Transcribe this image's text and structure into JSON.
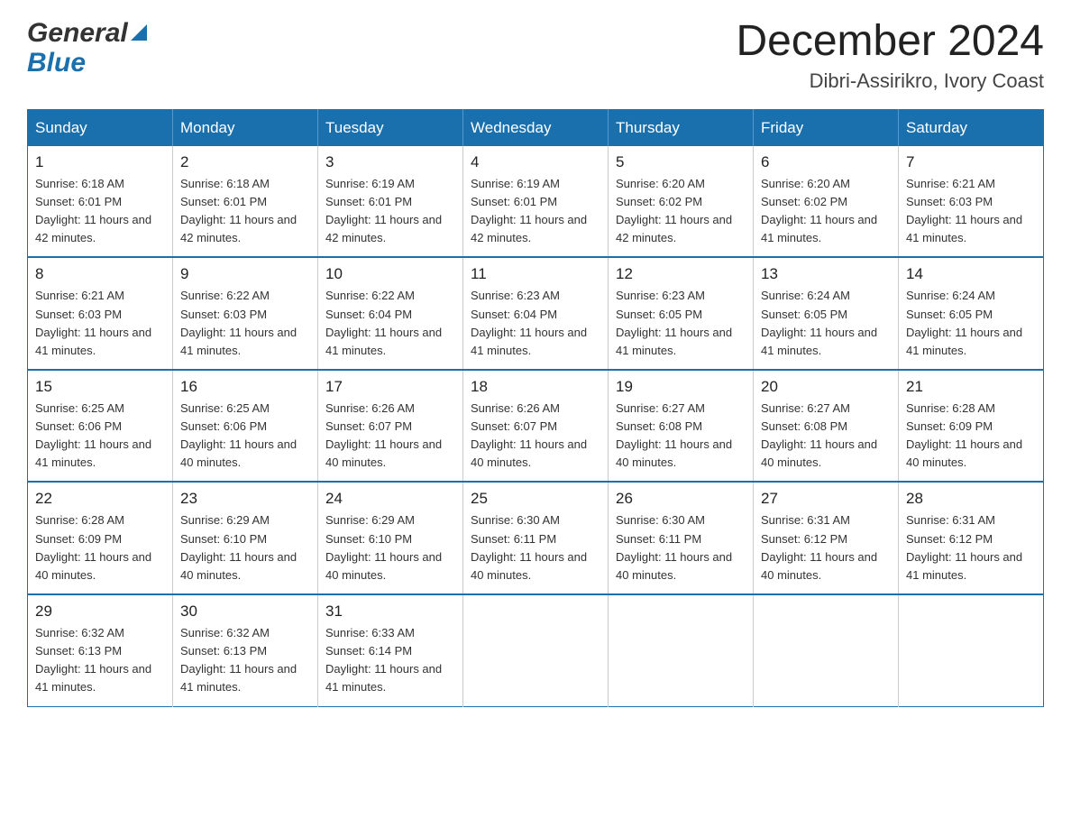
{
  "header": {
    "logo_general": "General",
    "logo_blue": "Blue",
    "main_title": "December 2024",
    "subtitle": "Dibri-Assirikro, Ivory Coast"
  },
  "calendar": {
    "days_of_week": [
      "Sunday",
      "Monday",
      "Tuesday",
      "Wednesday",
      "Thursday",
      "Friday",
      "Saturday"
    ],
    "weeks": [
      [
        {
          "day": "1",
          "sunrise": "6:18 AM",
          "sunset": "6:01 PM",
          "daylight": "11 hours and 42 minutes."
        },
        {
          "day": "2",
          "sunrise": "6:18 AM",
          "sunset": "6:01 PM",
          "daylight": "11 hours and 42 minutes."
        },
        {
          "day": "3",
          "sunrise": "6:19 AM",
          "sunset": "6:01 PM",
          "daylight": "11 hours and 42 minutes."
        },
        {
          "day": "4",
          "sunrise": "6:19 AM",
          "sunset": "6:01 PM",
          "daylight": "11 hours and 42 minutes."
        },
        {
          "day": "5",
          "sunrise": "6:20 AM",
          "sunset": "6:02 PM",
          "daylight": "11 hours and 42 minutes."
        },
        {
          "day": "6",
          "sunrise": "6:20 AM",
          "sunset": "6:02 PM",
          "daylight": "11 hours and 41 minutes."
        },
        {
          "day": "7",
          "sunrise": "6:21 AM",
          "sunset": "6:03 PM",
          "daylight": "11 hours and 41 minutes."
        }
      ],
      [
        {
          "day": "8",
          "sunrise": "6:21 AM",
          "sunset": "6:03 PM",
          "daylight": "11 hours and 41 minutes."
        },
        {
          "day": "9",
          "sunrise": "6:22 AM",
          "sunset": "6:03 PM",
          "daylight": "11 hours and 41 minutes."
        },
        {
          "day": "10",
          "sunrise": "6:22 AM",
          "sunset": "6:04 PM",
          "daylight": "11 hours and 41 minutes."
        },
        {
          "day": "11",
          "sunrise": "6:23 AM",
          "sunset": "6:04 PM",
          "daylight": "11 hours and 41 minutes."
        },
        {
          "day": "12",
          "sunrise": "6:23 AM",
          "sunset": "6:05 PM",
          "daylight": "11 hours and 41 minutes."
        },
        {
          "day": "13",
          "sunrise": "6:24 AM",
          "sunset": "6:05 PM",
          "daylight": "11 hours and 41 minutes."
        },
        {
          "day": "14",
          "sunrise": "6:24 AM",
          "sunset": "6:05 PM",
          "daylight": "11 hours and 41 minutes."
        }
      ],
      [
        {
          "day": "15",
          "sunrise": "6:25 AM",
          "sunset": "6:06 PM",
          "daylight": "11 hours and 41 minutes."
        },
        {
          "day": "16",
          "sunrise": "6:25 AM",
          "sunset": "6:06 PM",
          "daylight": "11 hours and 40 minutes."
        },
        {
          "day": "17",
          "sunrise": "6:26 AM",
          "sunset": "6:07 PM",
          "daylight": "11 hours and 40 minutes."
        },
        {
          "day": "18",
          "sunrise": "6:26 AM",
          "sunset": "6:07 PM",
          "daylight": "11 hours and 40 minutes."
        },
        {
          "day": "19",
          "sunrise": "6:27 AM",
          "sunset": "6:08 PM",
          "daylight": "11 hours and 40 minutes."
        },
        {
          "day": "20",
          "sunrise": "6:27 AM",
          "sunset": "6:08 PM",
          "daylight": "11 hours and 40 minutes."
        },
        {
          "day": "21",
          "sunrise": "6:28 AM",
          "sunset": "6:09 PM",
          "daylight": "11 hours and 40 minutes."
        }
      ],
      [
        {
          "day": "22",
          "sunrise": "6:28 AM",
          "sunset": "6:09 PM",
          "daylight": "11 hours and 40 minutes."
        },
        {
          "day": "23",
          "sunrise": "6:29 AM",
          "sunset": "6:10 PM",
          "daylight": "11 hours and 40 minutes."
        },
        {
          "day": "24",
          "sunrise": "6:29 AM",
          "sunset": "6:10 PM",
          "daylight": "11 hours and 40 minutes."
        },
        {
          "day": "25",
          "sunrise": "6:30 AM",
          "sunset": "6:11 PM",
          "daylight": "11 hours and 40 minutes."
        },
        {
          "day": "26",
          "sunrise": "6:30 AM",
          "sunset": "6:11 PM",
          "daylight": "11 hours and 40 minutes."
        },
        {
          "day": "27",
          "sunrise": "6:31 AM",
          "sunset": "6:12 PM",
          "daylight": "11 hours and 40 minutes."
        },
        {
          "day": "28",
          "sunrise": "6:31 AM",
          "sunset": "6:12 PM",
          "daylight": "11 hours and 41 minutes."
        }
      ],
      [
        {
          "day": "29",
          "sunrise": "6:32 AM",
          "sunset": "6:13 PM",
          "daylight": "11 hours and 41 minutes."
        },
        {
          "day": "30",
          "sunrise": "6:32 AM",
          "sunset": "6:13 PM",
          "daylight": "11 hours and 41 minutes."
        },
        {
          "day": "31",
          "sunrise": "6:33 AM",
          "sunset": "6:14 PM",
          "daylight": "11 hours and 41 minutes."
        },
        null,
        null,
        null,
        null
      ]
    ]
  }
}
